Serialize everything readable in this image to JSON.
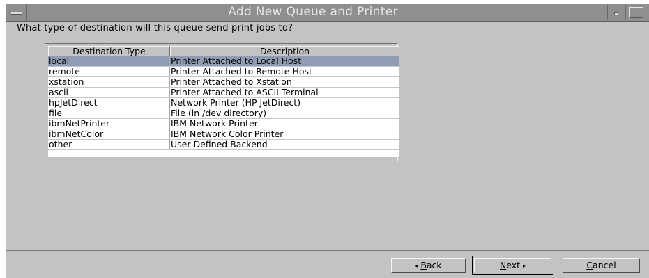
{
  "window": {
    "title": "Add New Queue and Printer"
  },
  "prompt": "What type of destination will this queue send print jobs to?",
  "table": {
    "columns": [
      "Destination Type",
      "Description"
    ],
    "rows": [
      {
        "type": "local",
        "description": "Printer Attached to Local Host",
        "selected": true
      },
      {
        "type": "remote",
        "description": "Printer Attached to Remote Host",
        "selected": false
      },
      {
        "type": "xstation",
        "description": "Printer Attached to Xstation",
        "selected": false
      },
      {
        "type": "ascii",
        "description": "Printer Attached to ASCII Terminal",
        "selected": false
      },
      {
        "type": "hpJetDirect",
        "description": "Network Printer (HP JetDirect)",
        "selected": false
      },
      {
        "type": "file",
        "description": "File (in /dev directory)",
        "selected": false
      },
      {
        "type": "ibmNetPrinter",
        "description": "IBM Network Printer",
        "selected": false
      },
      {
        "type": "ibmNetColor",
        "description": "IBM Network Color Printer",
        "selected": false
      },
      {
        "type": "other",
        "description": "User Defined Backend",
        "selected": false
      }
    ]
  },
  "buttons": {
    "back": {
      "mnemonic": "B",
      "rest": "ack",
      "arrow": "◂"
    },
    "next": {
      "mnemonic": "N",
      "rest": "ext",
      "arrow": "▸"
    },
    "cancel": {
      "mnemonic": "C",
      "rest": "ancel"
    }
  },
  "icons": {
    "window_menu": "window-menu-icon",
    "minimize": "minimize-icon",
    "maximize": "maximize-icon",
    "back_arrow": "left-arrow-icon",
    "next_arrow": "right-arrow-icon"
  },
  "colors": {
    "titlebar": "#8f8f8f",
    "background": "#c3c3c3",
    "selection": "#909cb4"
  }
}
